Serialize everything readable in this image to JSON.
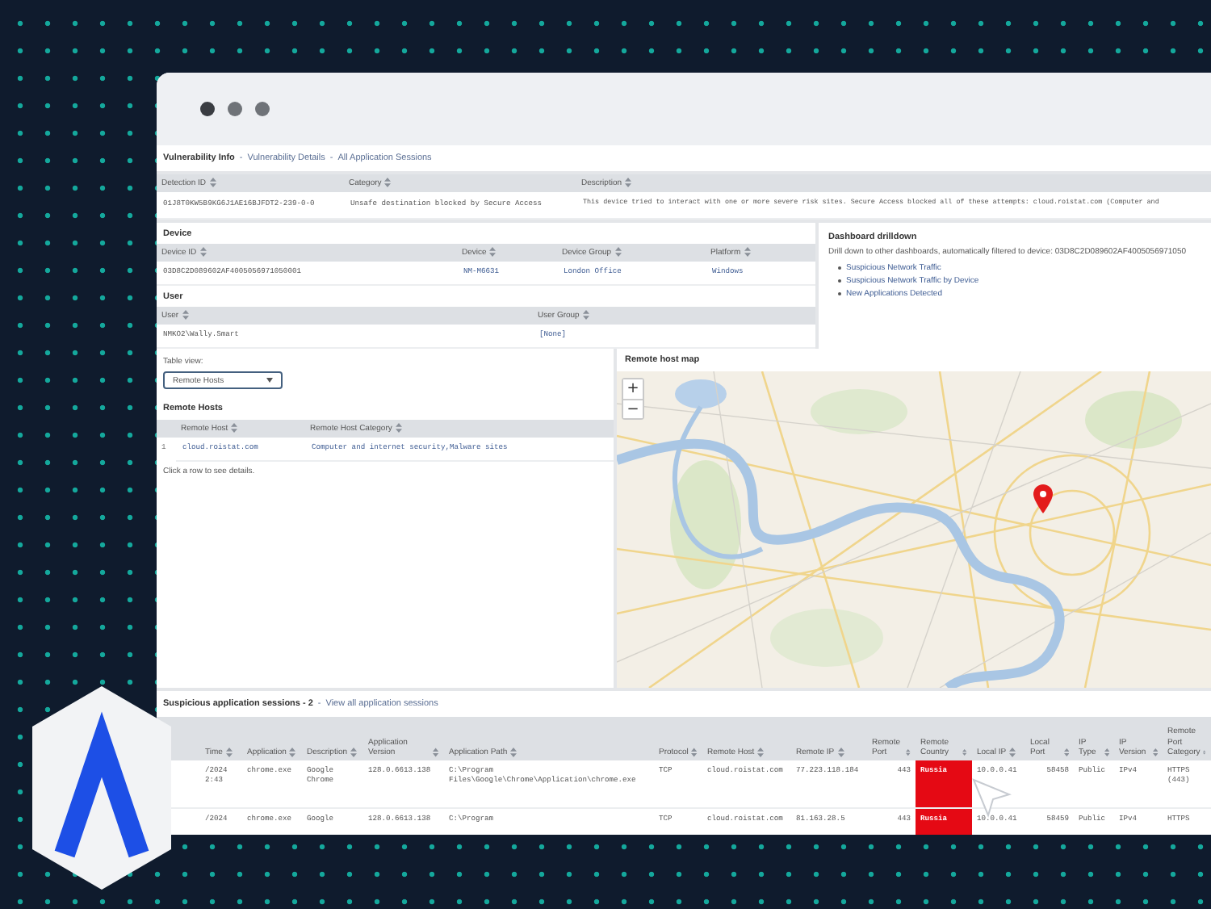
{
  "breadcrumb": {
    "items": [
      "Vulnerability Info",
      "Vulnerability Details",
      "All Application Sessions"
    ],
    "separator": "-"
  },
  "detection_table": {
    "columns": [
      {
        "label": "Detection ID",
        "kind": "text"
      },
      {
        "label": "Category",
        "kind": "text"
      },
      {
        "label": "Description",
        "kind": "text"
      }
    ],
    "rows": [
      {
        "cells": [
          "01J8T0KW5B9KG6J1AE16BJFDT2-239-0-0",
          "Unsafe destination blocked by Secure Access",
          "This device tried to interact with one or more severe risk sites. Secure Access blocked all of these attempts: cloud.roistat.com (Computer and"
        ]
      }
    ]
  },
  "device": {
    "heading": "Device",
    "columns": [
      {
        "label": "Device ID",
        "kind": "text"
      },
      {
        "label": "Device",
        "kind": "link"
      },
      {
        "label": "Device Group",
        "kind": "link"
      },
      {
        "label": "Platform",
        "kind": "link"
      }
    ],
    "rows": [
      {
        "cells": [
          "03D8C2D089602AF4005056971050001",
          "NM-M6631",
          "London Office",
          "Windows"
        ]
      }
    ]
  },
  "user": {
    "heading": "User",
    "columns": [
      {
        "label": "User",
        "kind": "text"
      },
      {
        "label": "User Group",
        "kind": "link"
      }
    ],
    "rows": [
      {
        "cells": [
          "NMKO2\\Wally.Smart",
          "[None]"
        ]
      }
    ]
  },
  "drilldown": {
    "title": "Dashboard drilldown",
    "text": "Drill down to other dashboards, automatically filtered to device: 03D8C2D089602AF4005056971050",
    "links": [
      "Suspicious Network Traffic",
      "Suspicious Network Traffic by Device",
      "New Applications Detected"
    ]
  },
  "table_view": {
    "label": "Table view:",
    "value": "Remote Hosts",
    "focused": true
  },
  "remote_hosts": {
    "title": "Remote Hosts",
    "columns": [
      {
        "label": "Remote Host",
        "kind": "link"
      },
      {
        "label": "Remote Host Category",
        "kind": "link"
      }
    ],
    "rows": [
      {
        "index": "1",
        "cells": [
          "cloud.roistat.com",
          "Computer and internet security,Malware sites"
        ]
      }
    ],
    "hint": "Click a row to see details."
  },
  "map": {
    "title": "Remote host map",
    "zoom_in": "+",
    "zoom_out": "−"
  },
  "sessions": {
    "title": "Suspicious application sessions - 2",
    "separator": "-",
    "link": "View all application sessions",
    "columns": [
      {
        "label": "Time",
        "kind": "text"
      },
      {
        "label": "Application",
        "kind": "text"
      },
      {
        "label": "Description",
        "kind": "text"
      },
      {
        "label": "Application Version",
        "kind": "text"
      },
      {
        "label": "Application Path",
        "kind": "text"
      },
      {
        "label": "Protocol",
        "kind": "text"
      },
      {
        "label": "Remote Host",
        "kind": "text"
      },
      {
        "label": "Remote IP",
        "kind": "text"
      },
      {
        "label": "Remote Port",
        "kind": "number"
      },
      {
        "label": "Remote Country",
        "kind": "country"
      },
      {
        "label": "Local IP",
        "kind": "text"
      },
      {
        "label": "Local Port",
        "kind": "number"
      },
      {
        "label": "IP Type",
        "kind": "text"
      },
      {
        "label": "IP Version",
        "kind": "text"
      },
      {
        "label": "Remote Port Category",
        "kind": "text"
      }
    ],
    "rows": [
      {
        "risky_country": true,
        "cells": [
          "/2024 2:43",
          "chrome.exe",
          "Google Chrome",
          "128.0.6613.138",
          "C:\\Program Files\\Google\\Chrome\\Application\\chrome.exe",
          "TCP",
          "cloud.roistat.com",
          "77.223.118.184",
          "443",
          "Russia",
          "10.0.0.41",
          "58458",
          "Public",
          "IPv4",
          "HTTPS (443)"
        ]
      },
      {
        "risky_country": true,
        "cells": [
          "/2024",
          "chrome.exe",
          "Google",
          "128.0.6613.138",
          "C:\\Program",
          "TCP",
          "cloud.roistat.com",
          "81.163.28.5",
          "443",
          "Russia",
          "10.0.0.41",
          "58459",
          "Public",
          "IPv4",
          "HTTPS"
        ]
      }
    ]
  }
}
